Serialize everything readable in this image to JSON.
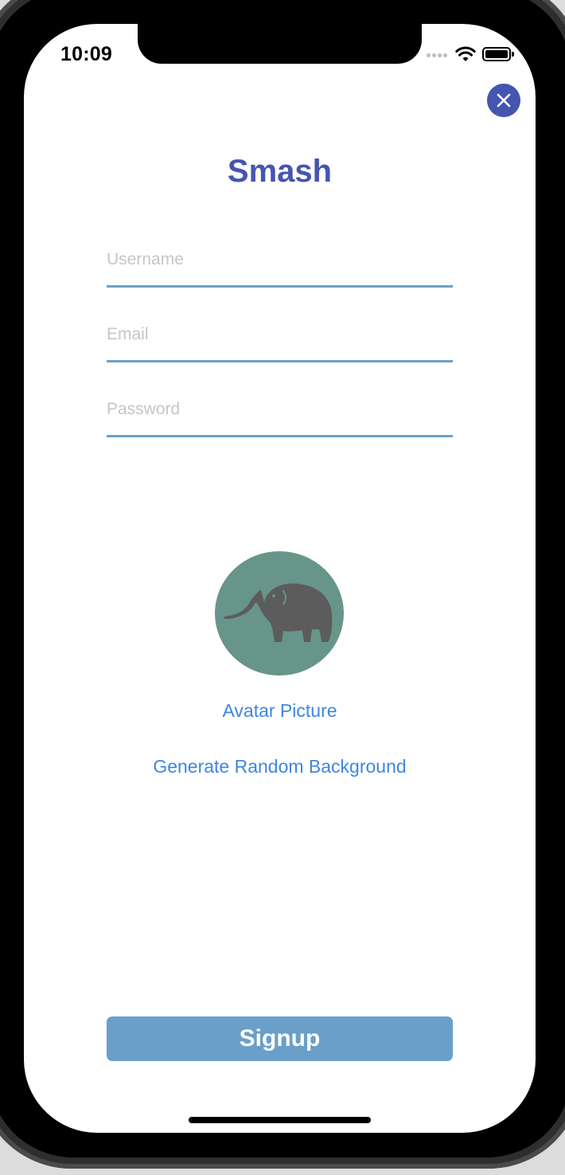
{
  "status_bar": {
    "time": "10:09"
  },
  "header": {
    "title": "Smash",
    "close_icon": "close-icon"
  },
  "form": {
    "username": {
      "placeholder": "Username",
      "value": ""
    },
    "email": {
      "placeholder": "Email",
      "value": ""
    },
    "password": {
      "placeholder": "Password",
      "value": ""
    }
  },
  "avatar": {
    "icon": "elephant-icon",
    "background_color": "#67958a"
  },
  "links": {
    "avatar_picture": "Avatar Picture",
    "generate_background": "Generate Random Background"
  },
  "actions": {
    "signup_label": "Signup"
  },
  "colors": {
    "accent": "#4555b0",
    "link": "#3f86df",
    "field_underline": "#6aa0ca",
    "signup_button": "#6a9fca"
  }
}
